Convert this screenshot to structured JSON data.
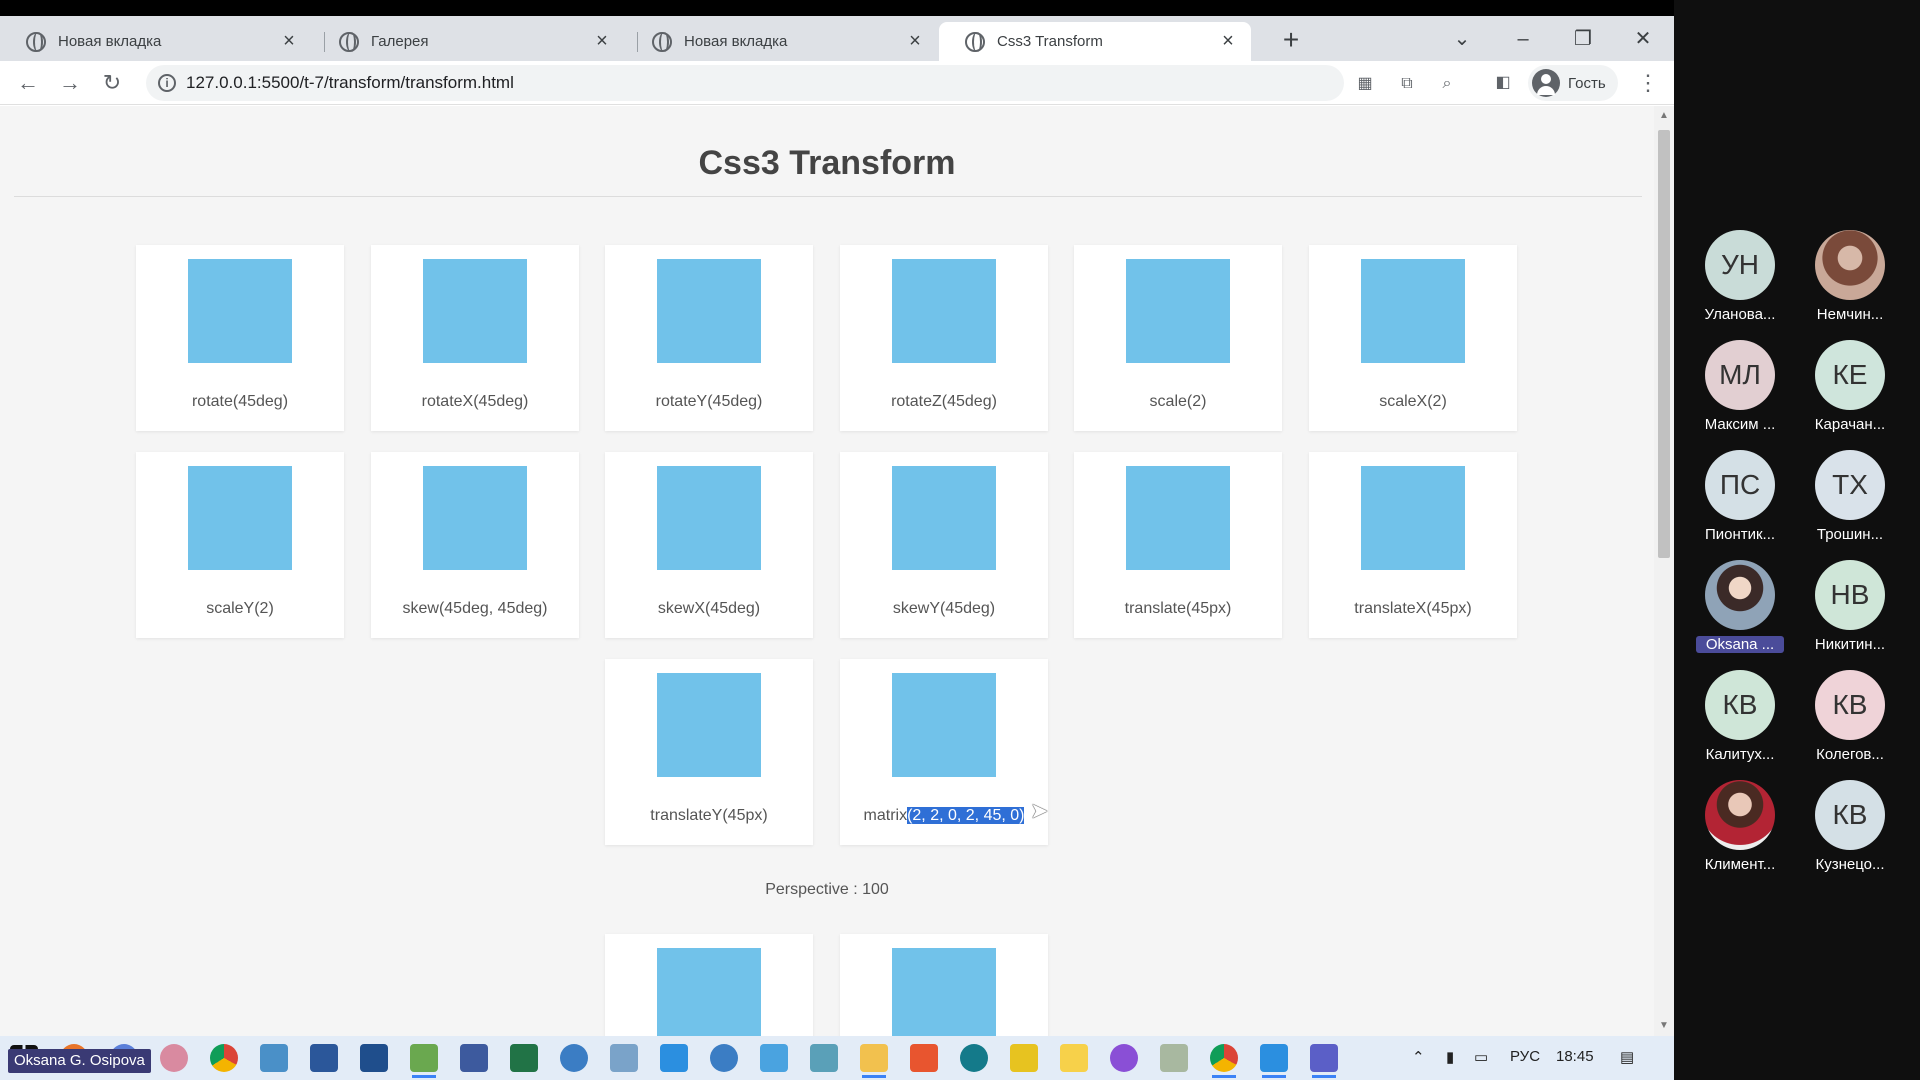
{
  "browser": {
    "tabs": [
      {
        "label": "Новая вкладка"
      },
      {
        "label": "Галерея"
      },
      {
        "label": "Новая вкладка"
      },
      {
        "label": "Css3 Transform"
      }
    ],
    "url": "127.0.0.1:5500/t-7/transform/transform.html",
    "profile_label": "Гость"
  },
  "page": {
    "title": "Css3 Transform",
    "cards": [
      "rotate(45deg)",
      "rotateX(45deg)",
      "rotateY(45deg)",
      "rotateZ(45deg)",
      "scale(2)",
      "scaleX(2)",
      "scaleY(2)",
      "skew(45deg, 45deg)",
      "skewX(45deg)",
      "skewY(45deg)",
      "translate(45px)",
      "translateX(45px)",
      "translateY(45px)"
    ],
    "matrix_card": {
      "prefix": "matrix",
      "selected": "(2, 2, 0, 2, 45, 0)"
    },
    "perspective_label": "Perspective : 100"
  },
  "taskbar": {
    "lang": "РУС",
    "time": "18:45"
  },
  "presenter": "Oksana G. Osipova",
  "participants": [
    {
      "initials": "УН",
      "name": "Уланова...",
      "color": "#c9dcd8"
    },
    {
      "initials": "",
      "name": "Немчин...",
      "photo": "photo"
    },
    {
      "initials": "МЛ",
      "name": "Максим ...",
      "color": "#e2cfd2"
    },
    {
      "initials": "КЕ",
      "name": "Карачан...",
      "color": "#cfe5dc"
    },
    {
      "initials": "ПС",
      "name": "Пионтик...",
      "color": "#d4e0e6"
    },
    {
      "initials": "ТХ",
      "name": "Трошин...",
      "color": "#d9e2ea"
    },
    {
      "initials": "",
      "name": "Oksana ...",
      "photo": "photo2",
      "selected": true
    },
    {
      "initials": "НВ",
      "name": "Никитин...",
      "color": "#cfe6d8"
    },
    {
      "initials": "КВ",
      "name": "Калитух...",
      "color": "#cfe6d8"
    },
    {
      "initials": "КВ",
      "name": "Колегов...",
      "color": "#efd3d8"
    },
    {
      "initials": "",
      "name": "Климент...",
      "photo": "photo3"
    },
    {
      "initials": "КВ",
      "name": "Кузнецо...",
      "color": "#d4e0e6"
    }
  ]
}
